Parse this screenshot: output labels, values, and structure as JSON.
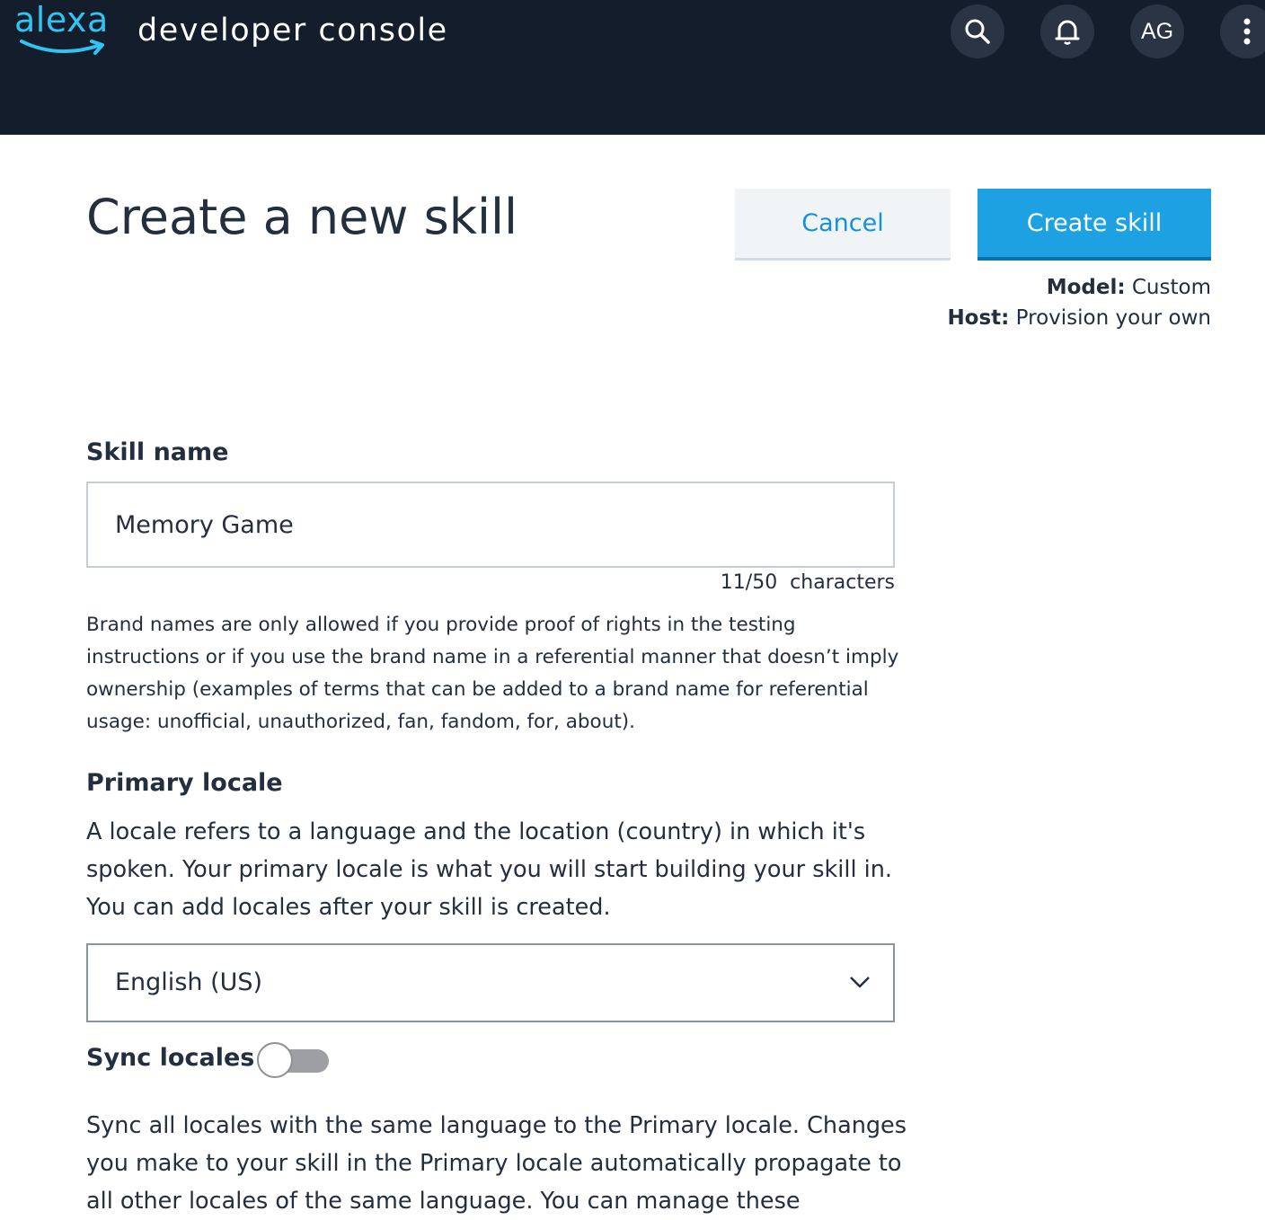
{
  "header": {
    "logo_text": "alexa",
    "title": "developer console",
    "avatar_initials": "AG",
    "background": "#141d2b"
  },
  "page": {
    "title": "Create a new skill",
    "cancel_label": "Cancel",
    "create_label": "Create skill",
    "model_key": "Model:",
    "model_value": " Custom",
    "host_key": "Host:",
    "host_value": " Provision your own"
  },
  "skill_name": {
    "label": "Skill name",
    "value": "Memory Game",
    "char_count": "11/50  characters",
    "note": "Brand names are only allowed if you provide proof of rights in the testing instructions or if you use the brand name in a referential manner that doesn’t imply ownership (examples of terms that can be added to a brand name for referential usage: unofficial, unauthorized, fan, fandom, for, about)."
  },
  "primary_locale": {
    "label": "Primary locale",
    "description": "A locale refers to a language and the location (country) in which it's spoken. Your primary locale is what you will start building your skill in. You can add locales after your skill is created.",
    "selected": "English (US)"
  },
  "sync_locales": {
    "label": "Sync locales",
    "enabled": false,
    "description": "Sync all locales with the same language to the Primary locale. Changes you make to your skill in the Primary locale automatically propagate to all other locales of the same language. You can manage these"
  },
  "colors": {
    "accent": "#1da1e2",
    "link": "#1592d4",
    "logo": "#31c4f3",
    "text": "#232f3e"
  }
}
